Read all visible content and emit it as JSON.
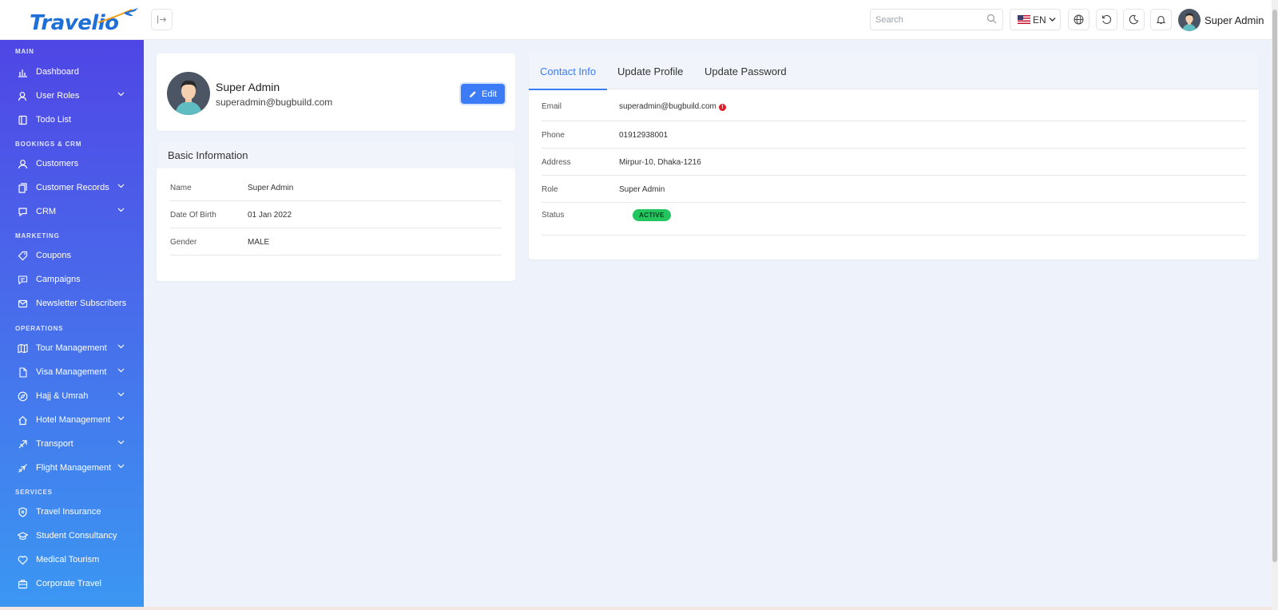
{
  "app": {
    "logo_text": "Travelio",
    "brand_color": "#1e6fd8",
    "accent_color": "#3b7cf6"
  },
  "topbar": {
    "search_placeholder": "Search",
    "language": "EN",
    "icons": [
      "collapse-sidebar-icon",
      "search-icon",
      "us-flag-icon",
      "globe-icon",
      "refresh-icon",
      "moon-icon",
      "bell-icon"
    ],
    "user_name": "Super Admin"
  },
  "sidebar": {
    "sections": {
      "main": "MAIN",
      "bookings": "BOOKINGS & CRM",
      "marketing": "MARKETING",
      "operations": "OPERATIONS",
      "services": "SERVICES"
    },
    "items": [
      {
        "label": "Dashboard",
        "icon": "chart-icon"
      },
      {
        "label": "User Roles",
        "icon": "user-roles-icon",
        "expandable": true
      },
      {
        "label": "Todo List",
        "icon": "todo-icon"
      },
      {
        "label": "Customers",
        "icon": "customer-icon"
      },
      {
        "label": "Customer Records",
        "icon": "records-icon",
        "expandable": true
      },
      {
        "label": "CRM",
        "icon": "chat-icon",
        "expandable": true
      },
      {
        "label": "Coupons",
        "icon": "tag-icon"
      },
      {
        "label": "Campaigns",
        "icon": "message-icon"
      },
      {
        "label": "Newsletter Subscribers",
        "icon": "mail-icon"
      },
      {
        "label": "Tour Management",
        "icon": "map-icon",
        "expandable": true
      },
      {
        "label": "Visa Management",
        "icon": "document-icon",
        "expandable": true
      },
      {
        "label": "Hajj & Umrah",
        "icon": "compass-icon",
        "expandable": true
      },
      {
        "label": "Hotel Management",
        "icon": "home-icon",
        "expandable": true
      },
      {
        "label": "Transport",
        "icon": "transport-icon",
        "expandable": true
      },
      {
        "label": "Flight Management",
        "icon": "plane-icon",
        "expandable": true
      },
      {
        "label": "Travel Insurance",
        "icon": "shield-icon"
      },
      {
        "label": "Student Consultancy",
        "icon": "graduation-cap-icon"
      },
      {
        "label": "Medical Tourism",
        "icon": "heart-icon"
      },
      {
        "label": "Corporate Travel",
        "icon": "briefcase-icon"
      }
    ]
  },
  "profile": {
    "name": "Super Admin",
    "email": "superadmin@bugbuild.com",
    "edit_label": "Edit"
  },
  "basic_info": {
    "title": "Basic Information",
    "rows": [
      {
        "key": "Name",
        "value": "Super Admin"
      },
      {
        "key": "Date Of Birth",
        "value": "01 Jan 2022"
      },
      {
        "key": "Gender",
        "value": "MALE"
      }
    ]
  },
  "contact": {
    "tabs": [
      {
        "label": "Contact Info",
        "active": true
      },
      {
        "label": "Update Profile",
        "active": false
      },
      {
        "label": "Update Password",
        "active": false
      }
    ],
    "rows": [
      {
        "key": "Email",
        "value": "superadmin@bugbuild.com"
      },
      {
        "key": "Phone",
        "value": "01912938001"
      },
      {
        "key": "Address",
        "value": "Mirpur-10, Dhaka-1216"
      },
      {
        "key": "Role",
        "value": "Super Admin"
      },
      {
        "key": "Status",
        "value": "ACTIVE"
      }
    ],
    "email_alert_symbol": "!",
    "status_color": "#22c55e"
  }
}
